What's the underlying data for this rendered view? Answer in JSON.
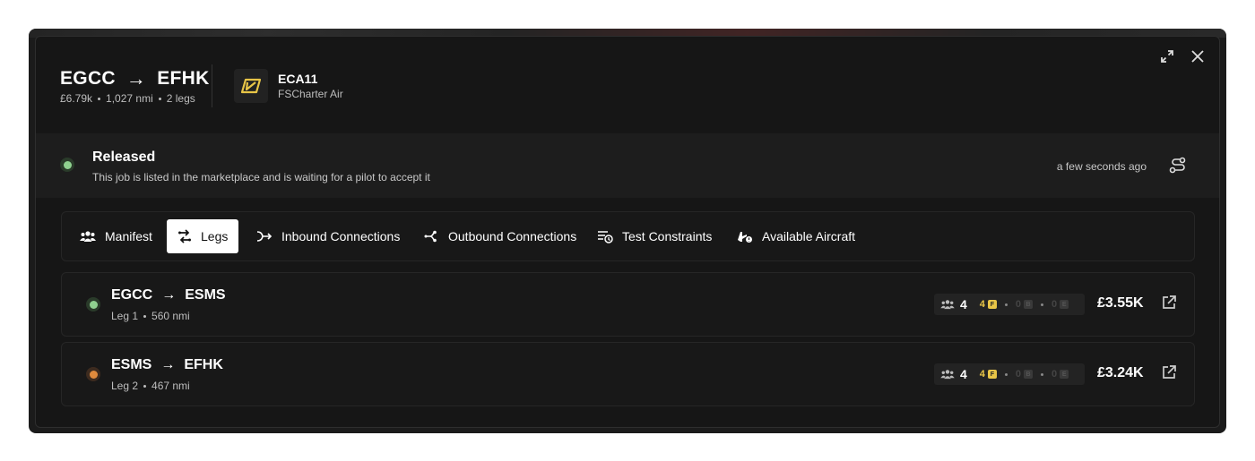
{
  "job": {
    "origin": "EGCC",
    "destination": "EFHK",
    "price": "£6.79k",
    "distance": "1,027 nmi",
    "legs_count": "2 legs"
  },
  "airline": {
    "code": "ECA11",
    "name": "FSCharter Air",
    "logo_color": "#e8c547"
  },
  "status": {
    "title": "Released",
    "description": "This job is listed in the marketplace and is waiting for a pilot to accept it",
    "time": "a few seconds ago",
    "color": "#8fd18f"
  },
  "tabs": [
    {
      "label": "Manifest",
      "icon": "users-icon",
      "active": false
    },
    {
      "label": "Legs",
      "icon": "legs-icon",
      "active": true
    },
    {
      "label": "Inbound Connections",
      "icon": "inbound-icon",
      "active": false
    },
    {
      "label": "Outbound Connections",
      "icon": "outbound-icon",
      "active": false
    },
    {
      "label": "Test Constraints",
      "icon": "constraints-icon",
      "active": false
    },
    {
      "label": "Available Aircraft",
      "icon": "aircraft-icon",
      "active": false
    }
  ],
  "legs": [
    {
      "origin": "EGCC",
      "destination": "ESMS",
      "leg_label": "Leg 1",
      "distance": "560 nmi",
      "pax": "4",
      "first": "4",
      "business": "0",
      "economy": "0",
      "price": "£3.55K",
      "status_color": "#8fd18f"
    },
    {
      "origin": "ESMS",
      "destination": "EFHK",
      "leg_label": "Leg 2",
      "distance": "467 nmi",
      "pax": "4",
      "first": "4",
      "business": "0",
      "economy": "0",
      "price": "£3.24K",
      "status_color": "#e08a3c"
    }
  ],
  "class_badges": {
    "first": "F",
    "business": "B",
    "economy": "E"
  }
}
